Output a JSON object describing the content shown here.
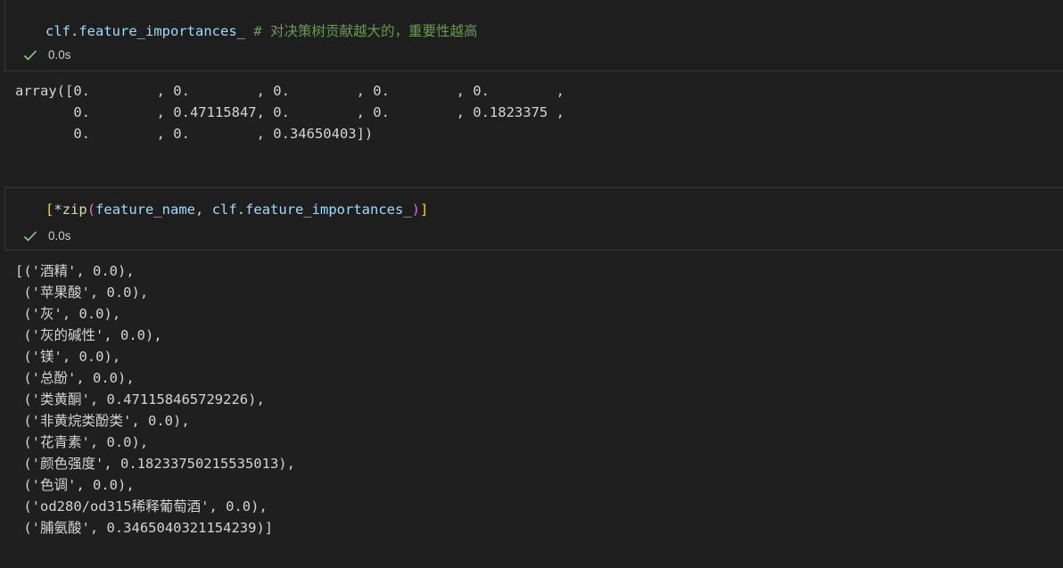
{
  "cells": [
    {
      "code": {
        "var": "clf",
        "dot": ".",
        "attr": "feature_importances_",
        "space": " ",
        "comment": "# 对决策树贡献越大的，重要性越高"
      },
      "status": {
        "icon": "checkmark-icon",
        "time": "0.0s"
      },
      "output_lines": [
        "array([0.        , 0.        , 0.        , 0.        , 0.        ,",
        "       0.        , 0.47115847, 0.        , 0.        , 0.1823375 ,",
        "       0.        , 0.        , 0.34650403])"
      ]
    },
    {
      "code": {
        "open_bracket": "[",
        "star": "*",
        "func": "zip",
        "open_paren": "(",
        "arg1": "feature_name",
        "comma": ", ",
        "arg2_obj": "clf",
        "arg2_dot": ".",
        "arg2_attr": "feature_importances_",
        "close_paren": ")",
        "close_bracket": "]"
      },
      "status": {
        "icon": "checkmark-icon",
        "time": "0.0s"
      },
      "output_lines": [
        "[('酒精', 0.0),",
        " ('苹果酸', 0.0),",
        " ('灰', 0.0),",
        " ('灰的碱性', 0.0),",
        " ('镁', 0.0),",
        " ('总酚', 0.0),",
        " ('类黄酮', 0.471158465729226),",
        " ('非黄烷类酚类', 0.0),",
        " ('花青素', 0.0),",
        " ('颜色强度', 0.18233750215535013),",
        " ('色调', 0.0),",
        " ('od280/od315稀释葡萄酒', 0.0),",
        " ('脯氨酸', 0.3465040321154239)]"
      ]
    }
  ],
  "colors": {
    "background": "#1f1f1f",
    "check": "#89d185",
    "comment": "#6a9955",
    "variable": "#9cdcfe",
    "function": "#dcdcaa",
    "bracket": "#ffd700",
    "paren": "#da70d6"
  }
}
